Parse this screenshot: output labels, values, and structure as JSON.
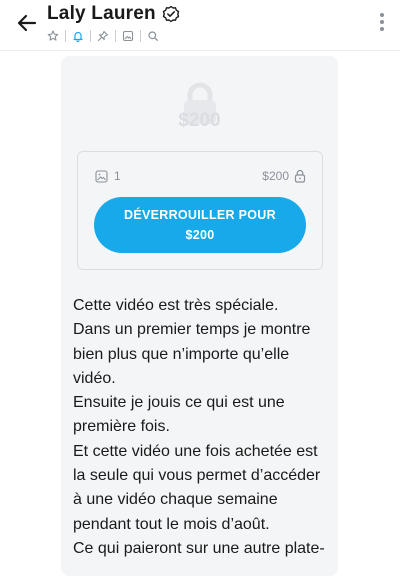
{
  "header": {
    "title": "Laly Lauren"
  },
  "post": {
    "price_watermark": "$200",
    "media_count": "1",
    "price": "$200",
    "unlock_line1": "DÉVERROUILLER POUR",
    "unlock_line2": "$200",
    "caption": [
      "Cette vidéo est très spéciale.",
      "Dans un premier temps je montre bien plus que n’importe qu’elle vidéo.",
      "Ensuite je jouis ce qui est une première fois.",
      "Et cette vidéo une fois achetée est la seule qui vous permet d’accéder à une vidéo chaque semaine pendant tout le mois d’août.",
      "Ce qui paieront sur une autre plate-"
    ]
  },
  "colors": {
    "accent": "#17a9e9",
    "muted": "#8a9199",
    "card_bg": "#f4f5f7"
  },
  "icons": [
    "back-arrow-icon",
    "verified-icon",
    "star-icon",
    "bell-icon",
    "pin-icon",
    "image-icon",
    "search-icon",
    "more-vertical-icon",
    "lock-icon"
  ]
}
